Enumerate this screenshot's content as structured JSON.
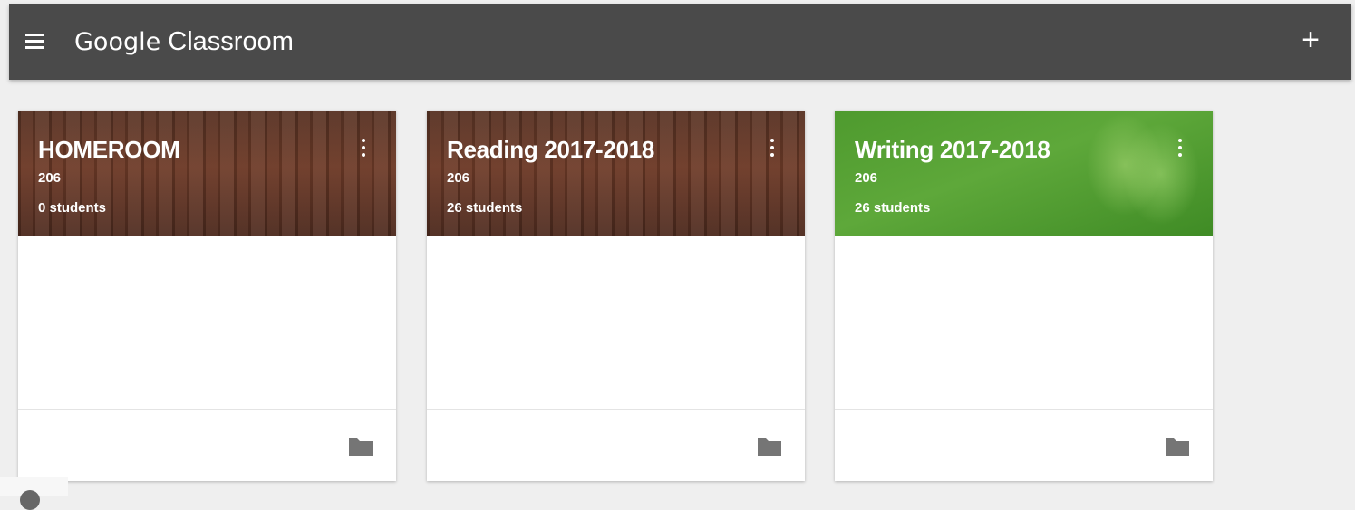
{
  "app": {
    "brand_google": "Google",
    "brand_product": "Classroom",
    "icons": {
      "menu": "menu-icon",
      "add": "plus-icon"
    },
    "add_glyph": "+"
  },
  "colors": {
    "topbar": "#4a4a4a",
    "background": "#efefef",
    "card": "#ffffff",
    "header_brown": "#6e3b28",
    "header_green": "#5ea83a",
    "folder_icon": "#757575"
  },
  "classes": [
    {
      "title": "HOMEROOM",
      "section": "206",
      "students": "0 students",
      "theme": "books",
      "icons": [
        "more-vert-icon",
        "folder-icon"
      ]
    },
    {
      "title": "Reading 2017-2018",
      "section": "206",
      "students": "26 students",
      "theme": "books",
      "icons": [
        "more-vert-icon",
        "folder-icon"
      ]
    },
    {
      "title": "Writing 2017-2018",
      "section": "206",
      "students": "26 students",
      "theme": "book-green",
      "icons": [
        "more-vert-icon",
        "folder-icon"
      ]
    }
  ]
}
